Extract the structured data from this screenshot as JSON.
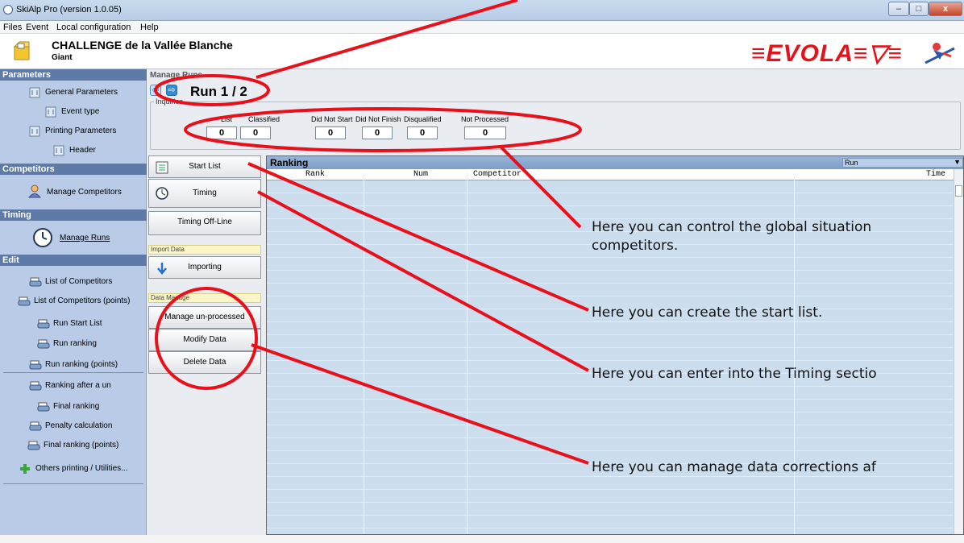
{
  "window": {
    "title": "SkiAlp Pro (version 1.0.05)"
  },
  "menu": [
    "Files",
    "Event",
    "Local configuration",
    "Help"
  ],
  "header": {
    "title": "CHALLENGE de la Vallée Blanche",
    "subtitle": "Giant",
    "logo": "EVOLA"
  },
  "sidebar": {
    "parameters": {
      "title": "Parameters",
      "items": [
        "General Parameters",
        "Event type",
        "Printing Parameters",
        "Header"
      ]
    },
    "competitors": {
      "title": "Competitors",
      "items": [
        "Manage Competitors"
      ]
    },
    "timing": {
      "title": "Timing",
      "items": [
        "Manage Runs"
      ]
    },
    "edit": {
      "title": "Edit",
      "items": [
        "List of Competitors",
        "List of Competitors (points)",
        "Run Start List",
        "Run ranking",
        "Run ranking (points)",
        "Ranking after a un",
        "Final ranking",
        "Penalty calculation",
        "Final ranking (points)",
        "Others printing / Utilities..."
      ]
    }
  },
  "main": {
    "page_title": "Manage Runs",
    "run_title": "Run 1 / 2",
    "inquiries": {
      "legend": "Inquiries",
      "headers": [
        "List",
        "Classified",
        "Did Not Start",
        "Did Not Finish",
        "Disqualified",
        "Not Processed"
      ],
      "values": [
        "0",
        "0",
        "0",
        "0",
        "0",
        "0"
      ]
    },
    "buttons": {
      "start_list": "Start List",
      "timing": "Timing",
      "timing_offline": "Timing Off-Line",
      "importing": "Importing",
      "manage_unprocessed": "Manage un-processed",
      "modify_data": "Modify Data",
      "delete_data": "Delete Data"
    },
    "groups": {
      "import": "Import Data",
      "data_manage": "Data Manage"
    },
    "ranking": {
      "title": "Ranking",
      "select_value": "Run",
      "columns": [
        "Rank",
        "Num",
        "Competitor",
        "Time"
      ]
    }
  },
  "annotations": {
    "global": [
      "Here you can control the global situation",
      "competitors."
    ],
    "start_list": "Here you can create the start list.",
    "timing": "Here you can enter into the Timing sectio",
    "data": "Here you can manage data corrections af"
  },
  "colors": {
    "annotation_red": "#e8101a",
    "sidebar_bg": "#b9cbe6",
    "section_header": "#5e7aa6",
    "grid_bg": "#ccddee"
  }
}
